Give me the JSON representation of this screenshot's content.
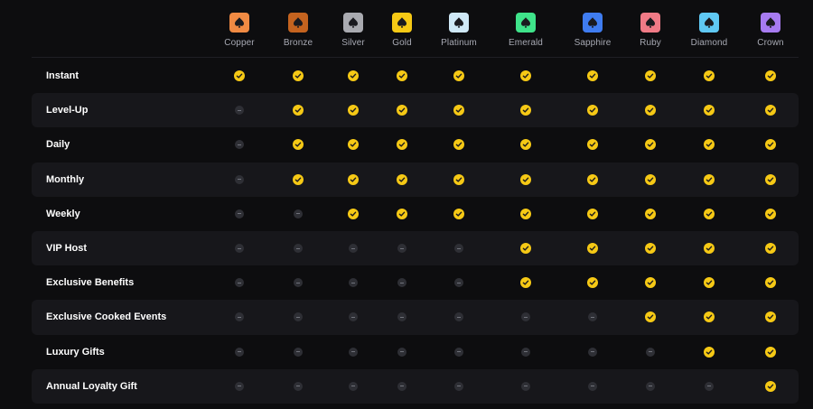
{
  "tiers": [
    {
      "name": "Copper",
      "color": "#f08a43"
    },
    {
      "name": "Bronze",
      "color": "#c4631f"
    },
    {
      "name": "Silver",
      "color": "#a9aab0"
    },
    {
      "name": "Gold",
      "color": "#f6c915"
    },
    {
      "name": "Platinum",
      "color": "#cfe8f6"
    },
    {
      "name": "Emerald",
      "color": "#3fe38a"
    },
    {
      "name": "Sapphire",
      "color": "#3f7cf0"
    },
    {
      "name": "Ruby",
      "color": "#f07a86"
    },
    {
      "name": "Diamond",
      "color": "#5fc8f3"
    },
    {
      "name": "Crown",
      "color": "#a77bf0"
    }
  ],
  "tier_icon": "spade-icon",
  "included_icon": "check-circle-icon",
  "excluded_icon": "minus-circle-icon",
  "colors": {
    "included": "#f6c915",
    "excluded": "#2e2f35",
    "row_alt": "#17171b"
  },
  "benefits": [
    {
      "label": "Instant",
      "available": [
        true,
        true,
        true,
        true,
        true,
        true,
        true,
        true,
        true,
        true
      ]
    },
    {
      "label": "Level-Up",
      "available": [
        false,
        true,
        true,
        true,
        true,
        true,
        true,
        true,
        true,
        true
      ]
    },
    {
      "label": "Daily",
      "available": [
        false,
        true,
        true,
        true,
        true,
        true,
        true,
        true,
        true,
        true
      ]
    },
    {
      "label": "Monthly",
      "available": [
        false,
        true,
        true,
        true,
        true,
        true,
        true,
        true,
        true,
        true
      ]
    },
    {
      "label": "Weekly",
      "available": [
        false,
        false,
        true,
        true,
        true,
        true,
        true,
        true,
        true,
        true
      ]
    },
    {
      "label": "VIP Host",
      "available": [
        false,
        false,
        false,
        false,
        false,
        true,
        true,
        true,
        true,
        true
      ]
    },
    {
      "label": "Exclusive Benefits",
      "available": [
        false,
        false,
        false,
        false,
        false,
        true,
        true,
        true,
        true,
        true
      ]
    },
    {
      "label": "Exclusive Cooked Events",
      "available": [
        false,
        false,
        false,
        false,
        false,
        false,
        false,
        true,
        true,
        true
      ]
    },
    {
      "label": "Luxury Gifts",
      "available": [
        false,
        false,
        false,
        false,
        false,
        false,
        false,
        false,
        true,
        true
      ]
    },
    {
      "label": "Annual Loyalty Gift",
      "available": [
        false,
        false,
        false,
        false,
        false,
        false,
        false,
        false,
        false,
        true
      ]
    }
  ]
}
